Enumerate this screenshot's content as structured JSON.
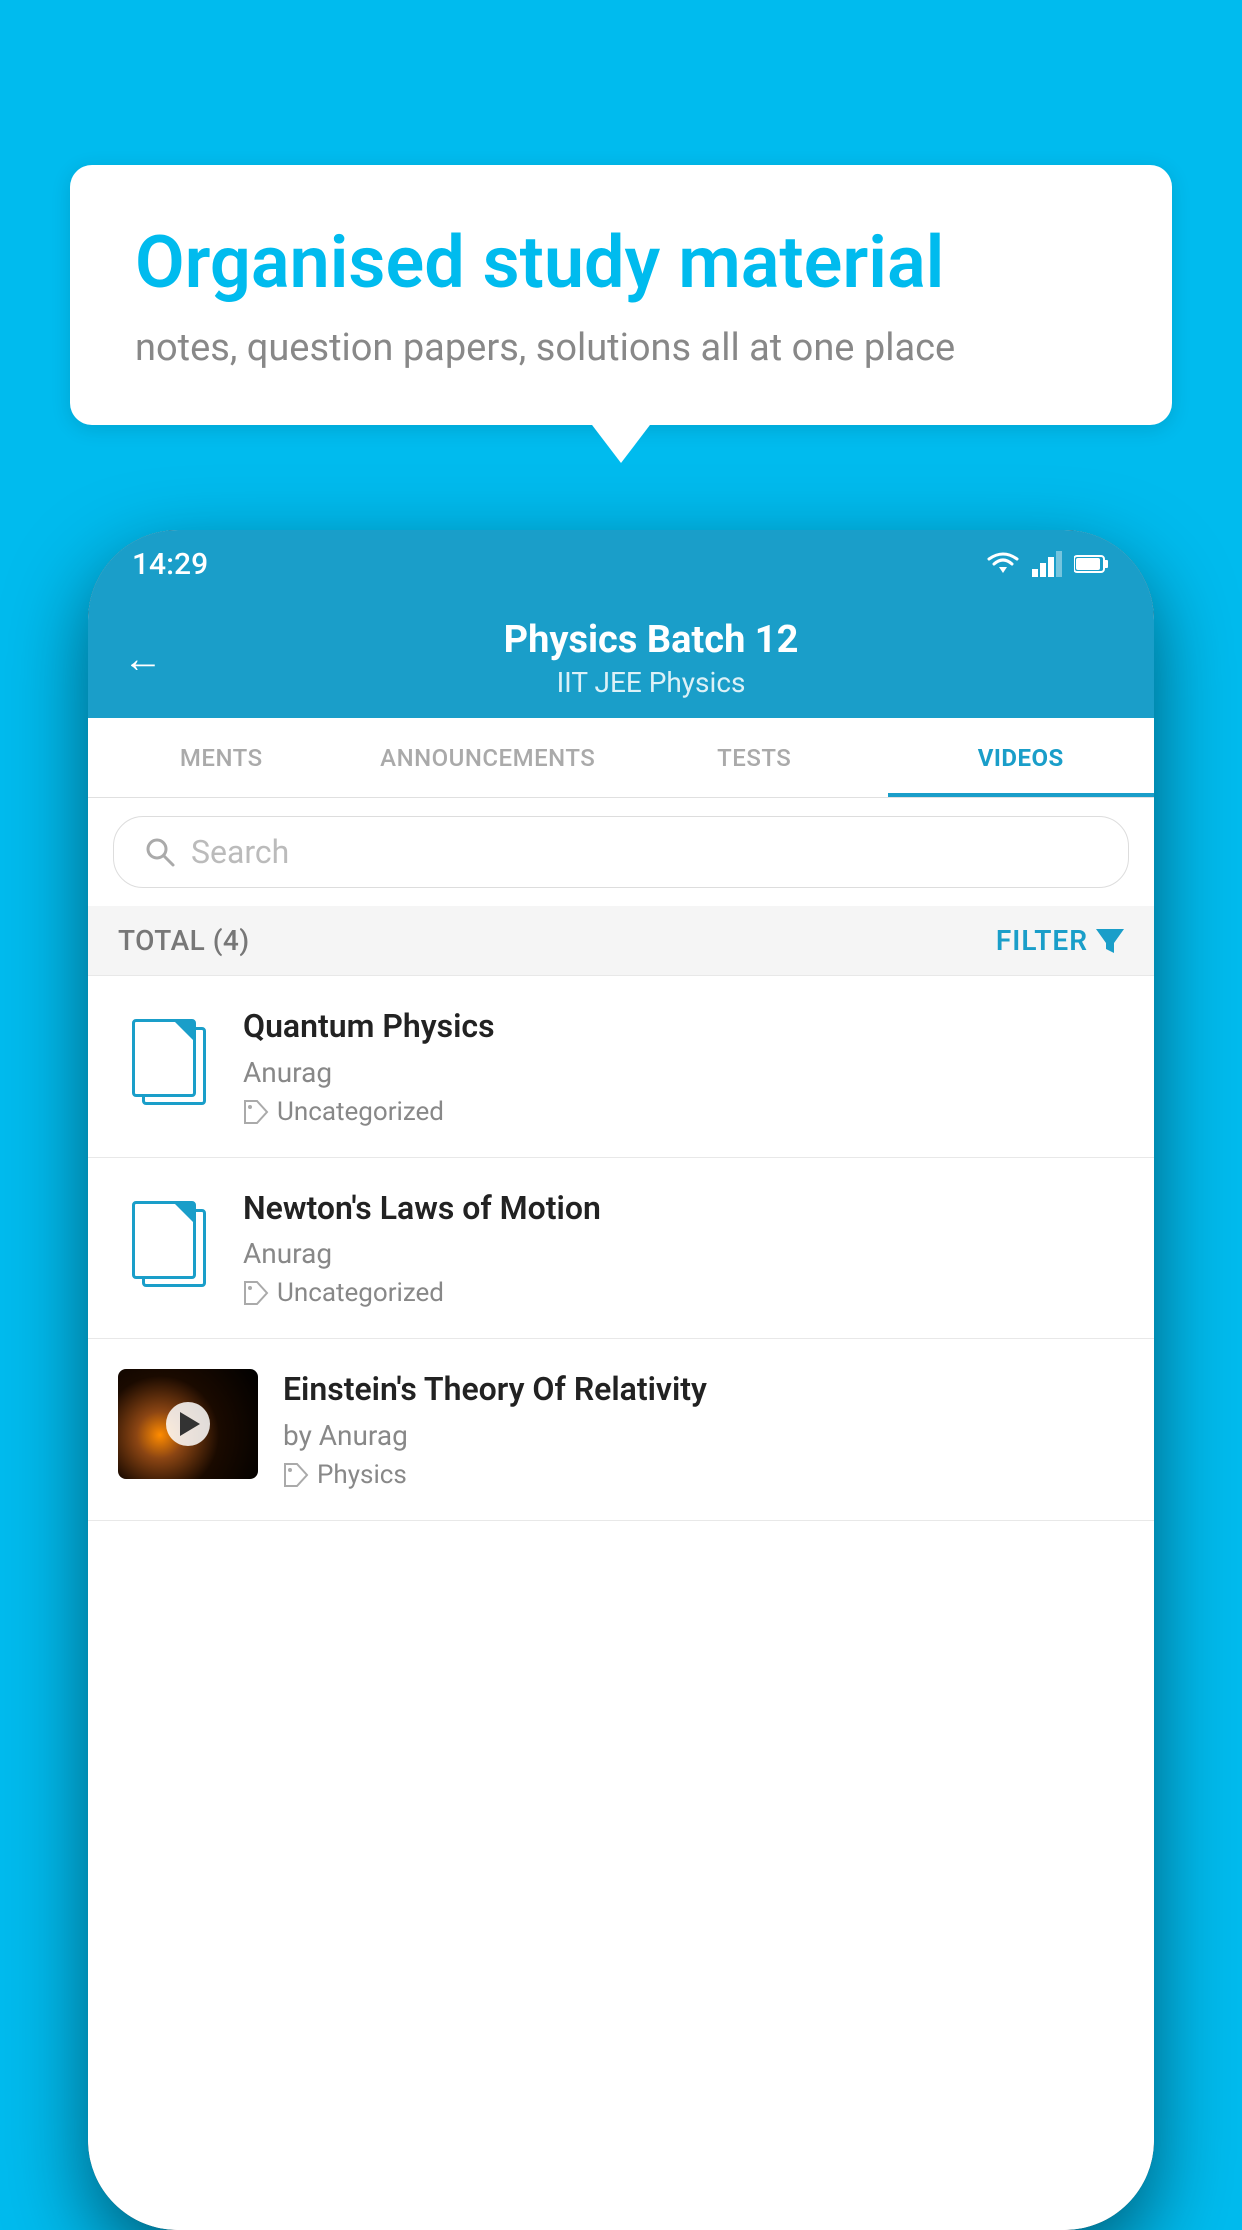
{
  "bubble": {
    "title": "Organised study material",
    "subtitle": "notes, question papers, solutions all at one place"
  },
  "status_bar": {
    "time": "14:29"
  },
  "header": {
    "title": "Physics Batch 12",
    "subtitle": "IIT JEE   Physics"
  },
  "tabs": [
    {
      "label": "MENTS",
      "active": false
    },
    {
      "label": "ANNOUNCEMENTS",
      "active": false
    },
    {
      "label": "TESTS",
      "active": false
    },
    {
      "label": "VIDEOS",
      "active": true
    }
  ],
  "search": {
    "placeholder": "Search"
  },
  "filter": {
    "total": "TOTAL (4)",
    "button": "FILTER"
  },
  "videos": [
    {
      "title": "Quantum Physics",
      "author": "Anurag",
      "tag": "Uncategorized",
      "type": "file"
    },
    {
      "title": "Newton's Laws of Motion",
      "author": "Anurag",
      "tag": "Uncategorized",
      "type": "file"
    },
    {
      "title": "Einstein's Theory Of Relativity",
      "author": "by Anurag",
      "tag": "Physics",
      "type": "video"
    }
  ]
}
